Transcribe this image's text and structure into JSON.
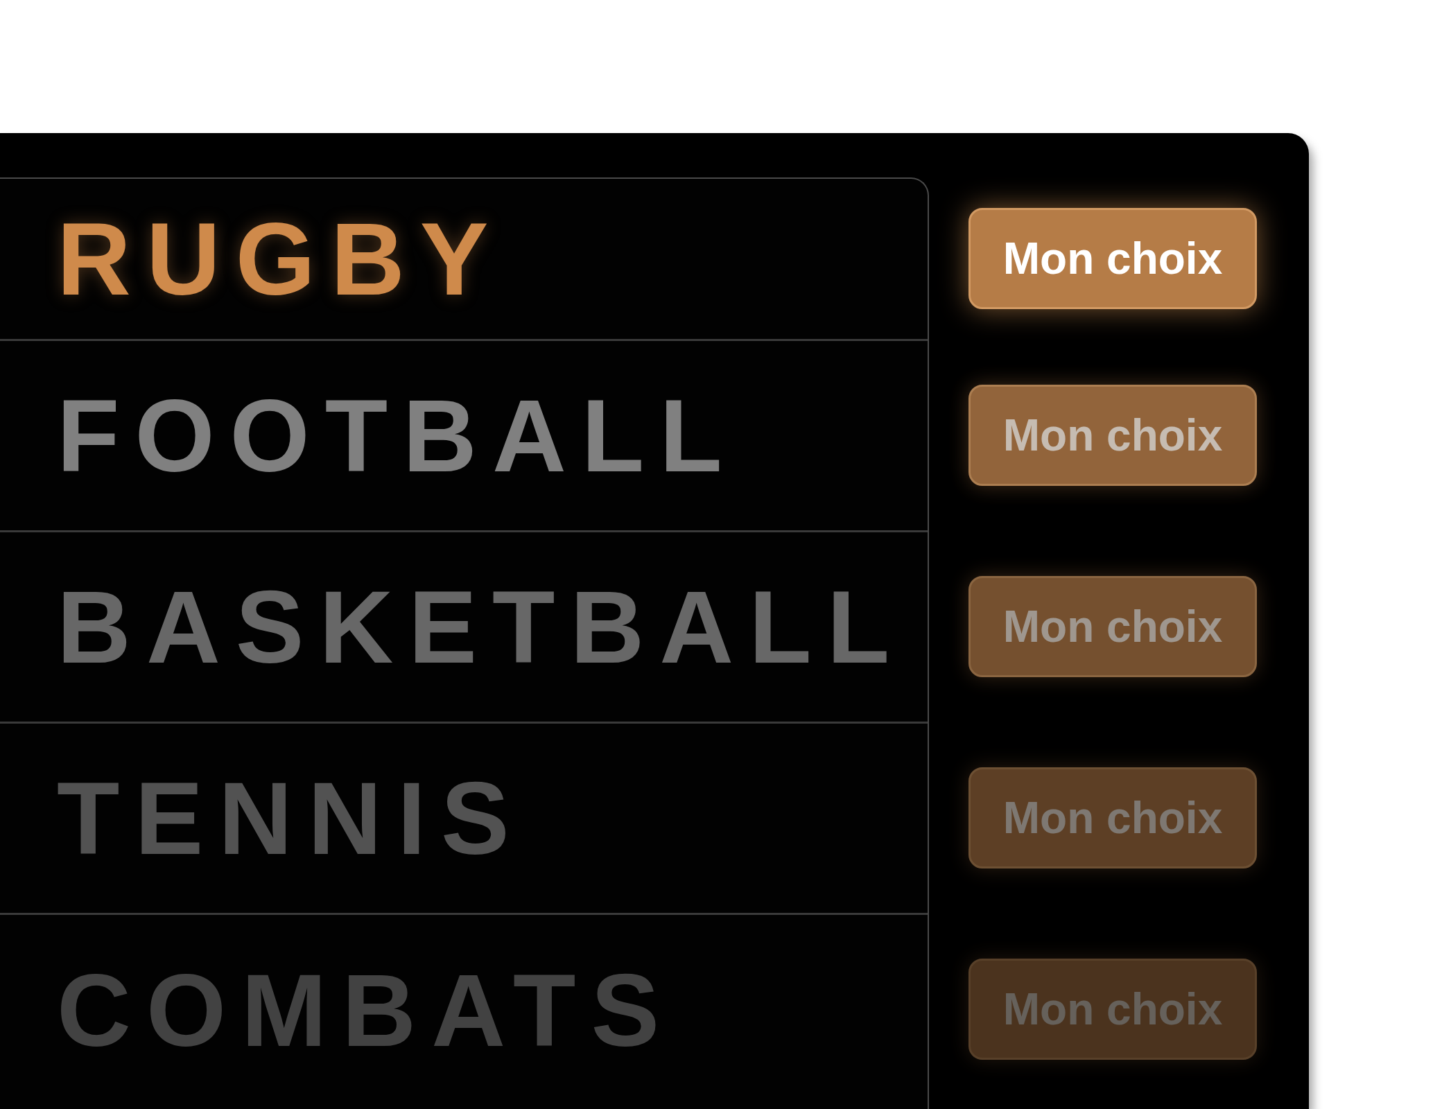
{
  "rows": [
    {
      "label": "RUGBY",
      "selected": true,
      "button": "Mon choix"
    },
    {
      "label": "FOOTBALL",
      "selected": false,
      "button": "Mon choix"
    },
    {
      "label": "BASKETBALL",
      "selected": false,
      "button": "Mon choix"
    },
    {
      "label": "TENNIS",
      "selected": false,
      "button": "Mon choix"
    },
    {
      "label": "COMBATS",
      "selected": false,
      "button": "Mon choix"
    }
  ]
}
